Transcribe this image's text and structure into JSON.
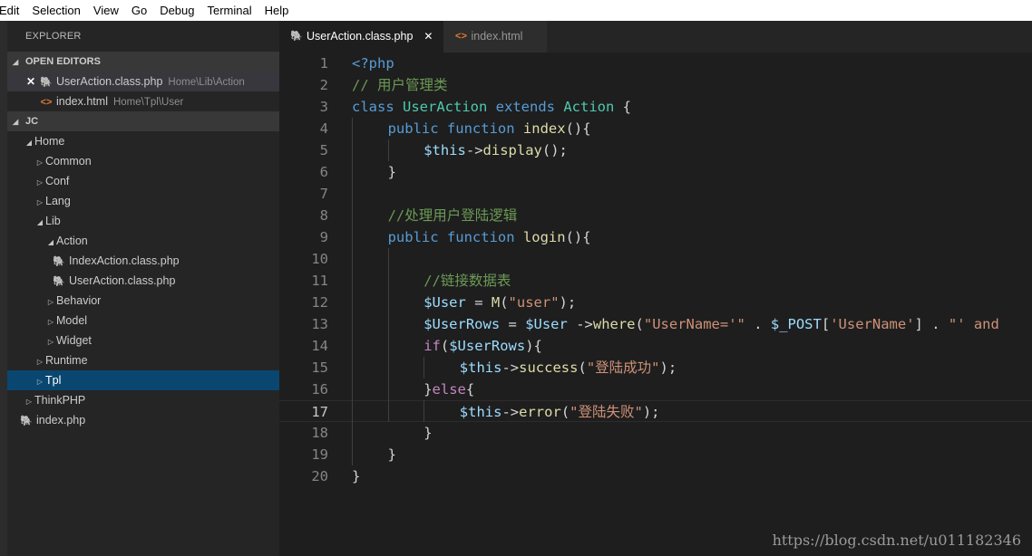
{
  "menu": [
    "Edit",
    "Selection",
    "View",
    "Go",
    "Debug",
    "Terminal",
    "Help"
  ],
  "explorer": {
    "title": "EXPLORER",
    "open_editors_label": "OPEN EDITORS",
    "open_editors": [
      {
        "name": "UserAction.class.php",
        "path": "Home\\Lib\\Action",
        "icon": "php-icon",
        "active": true
      },
      {
        "name": "index.html",
        "path": "Home\\Tpl\\User",
        "icon": "html-icon"
      }
    ],
    "project_label": "JC",
    "tree": [
      {
        "label": "Home",
        "depth": 1,
        "type": "folder",
        "expanded": true
      },
      {
        "label": "Common",
        "depth": 2,
        "type": "folder"
      },
      {
        "label": "Conf",
        "depth": 2,
        "type": "folder"
      },
      {
        "label": "Lang",
        "depth": 2,
        "type": "folder"
      },
      {
        "label": "Lib",
        "depth": 2,
        "type": "folder",
        "expanded": true
      },
      {
        "label": "Action",
        "depth": 3,
        "type": "folder",
        "expanded": true
      },
      {
        "label": "IndexAction.class.php",
        "depth": 4,
        "type": "php"
      },
      {
        "label": "UserAction.class.php",
        "depth": 4,
        "type": "php"
      },
      {
        "label": "Behavior",
        "depth": 3,
        "type": "folder"
      },
      {
        "label": "Model",
        "depth": 3,
        "type": "folder"
      },
      {
        "label": "Widget",
        "depth": 3,
        "type": "folder"
      },
      {
        "label": "Runtime",
        "depth": 2,
        "type": "folder"
      },
      {
        "label": "Tpl",
        "depth": 2,
        "type": "folder",
        "selected": true
      },
      {
        "label": "ThinkPHP",
        "depth": 1,
        "type": "folder"
      },
      {
        "label": "index.php",
        "depth": 1,
        "type": "php"
      }
    ]
  },
  "tabs": [
    {
      "label": "UserAction.class.php",
      "icon": "php-icon",
      "active": true
    },
    {
      "label": "index.html",
      "icon": "html-icon",
      "active": false
    }
  ],
  "editor": {
    "current_line": 17,
    "lines": [
      {
        "n": "1",
        "indent": 0,
        "tokens": [
          [
            "kw",
            "<?php"
          ]
        ]
      },
      {
        "n": "2",
        "indent": 0,
        "tokens": [
          [
            "cm",
            "// 用户管理类"
          ]
        ]
      },
      {
        "n": "3",
        "indent": 0,
        "tokens": [
          [
            "kw",
            "class "
          ],
          [
            "cls",
            "UserAction"
          ],
          [
            "kw",
            " extends "
          ],
          [
            "cls",
            "Action"
          ],
          [
            "pl",
            " {"
          ]
        ]
      },
      {
        "n": "4",
        "indent": 1,
        "tokens": [
          [
            "kw",
            "public "
          ],
          [
            "kw",
            "function "
          ],
          [
            "fn",
            "index"
          ],
          [
            "pl",
            "(){"
          ]
        ]
      },
      {
        "n": "5",
        "indent": 2,
        "tokens": [
          [
            "var",
            "$this"
          ],
          [
            "pl",
            "->"
          ],
          [
            "fn",
            "display"
          ],
          [
            "pl",
            "();"
          ]
        ]
      },
      {
        "n": "6",
        "indent": 1,
        "tokens": [
          [
            "pl",
            "}"
          ]
        ]
      },
      {
        "n": "7",
        "indent": 0,
        "tokens": []
      },
      {
        "n": "8",
        "indent": 1,
        "tokens": [
          [
            "cm",
            "//处理用户登陆逻辑"
          ]
        ]
      },
      {
        "n": "9",
        "indent": 1,
        "tokens": [
          [
            "kw",
            "public "
          ],
          [
            "kw",
            "function "
          ],
          [
            "fn",
            "login"
          ],
          [
            "pl",
            "(){"
          ]
        ]
      },
      {
        "n": "10",
        "indent": 0,
        "tokens": []
      },
      {
        "n": "11",
        "indent": 2,
        "tokens": [
          [
            "cm",
            "//链接数据表"
          ]
        ]
      },
      {
        "n": "12",
        "indent": 2,
        "tokens": [
          [
            "var",
            "$User"
          ],
          [
            "pl",
            " = "
          ],
          [
            "fn",
            "M"
          ],
          [
            "pl",
            "("
          ],
          [
            "str",
            "\"user\""
          ],
          [
            "pl",
            ");"
          ]
        ]
      },
      {
        "n": "13",
        "indent": 2,
        "tokens": [
          [
            "var",
            "$UserRows"
          ],
          [
            "pl",
            " = "
          ],
          [
            "var",
            "$User"
          ],
          [
            "pl",
            " ->"
          ],
          [
            "fn",
            "where"
          ],
          [
            "pl",
            "("
          ],
          [
            "str",
            "\"UserName='\""
          ],
          [
            "pl",
            " . "
          ],
          [
            "var",
            "$_POST"
          ],
          [
            "pl",
            "["
          ],
          [
            "str",
            "'UserName'"
          ],
          [
            "pl",
            "] . "
          ],
          [
            "str",
            "\"' and"
          ]
        ]
      },
      {
        "n": "14",
        "indent": 2,
        "tokens": [
          [
            "ctl",
            "if"
          ],
          [
            "pl",
            "("
          ],
          [
            "var",
            "$UserRows"
          ],
          [
            "pl",
            "){"
          ]
        ]
      },
      {
        "n": "15",
        "indent": 3,
        "tokens": [
          [
            "var",
            "$this"
          ],
          [
            "pl",
            "->"
          ],
          [
            "fn",
            "success"
          ],
          [
            "pl",
            "("
          ],
          [
            "str",
            "\"登陆成功\""
          ],
          [
            "pl",
            ");"
          ]
        ]
      },
      {
        "n": "16",
        "indent": 2,
        "tokens": [
          [
            "pl",
            "}"
          ],
          [
            "ctl",
            "else"
          ],
          [
            "pl",
            "{"
          ]
        ]
      },
      {
        "n": "17",
        "indent": 3,
        "tokens": [
          [
            "var",
            "$this"
          ],
          [
            "pl",
            "->"
          ],
          [
            "fn",
            "error"
          ],
          [
            "pl",
            "("
          ],
          [
            "str",
            "\"登陆失败\""
          ],
          [
            "pl",
            ");"
          ]
        ]
      },
      {
        "n": "18",
        "indent": 2,
        "tokens": [
          [
            "pl",
            "}"
          ]
        ]
      },
      {
        "n": "19",
        "indent": 1,
        "tokens": [
          [
            "pl",
            "}"
          ]
        ]
      },
      {
        "n": "20",
        "indent": 0,
        "tokens": [
          [
            "pl",
            "}"
          ]
        ]
      }
    ]
  },
  "watermark": "https://blog.csdn.net/u011182346"
}
